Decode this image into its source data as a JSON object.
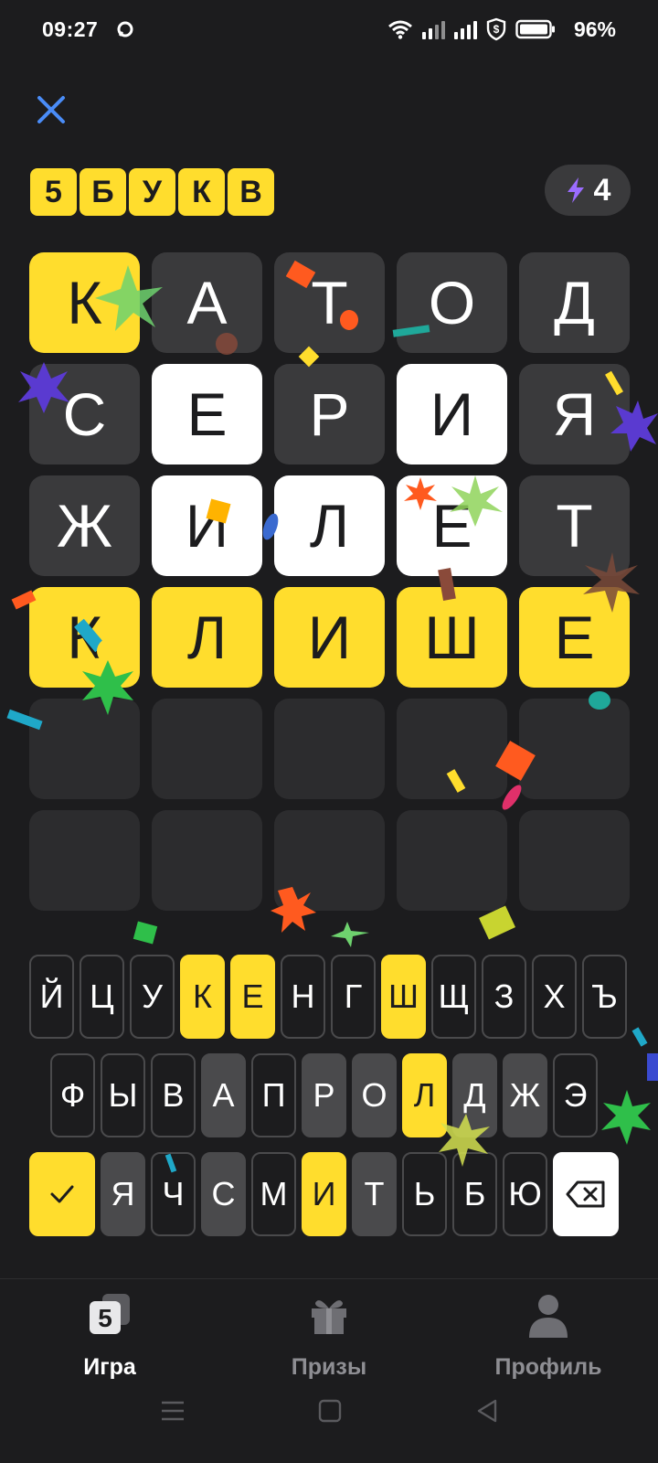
{
  "status_bar": {
    "time": "09:27",
    "battery": "96%"
  },
  "header": {
    "logo_letters": [
      "5",
      "Б",
      "У",
      "К",
      "В"
    ],
    "energy_count": "4"
  },
  "board": {
    "rows": [
      [
        {
          "letter": "К",
          "state": "correct"
        },
        {
          "letter": "А",
          "state": "absent"
        },
        {
          "letter": "Т",
          "state": "absent"
        },
        {
          "letter": "О",
          "state": "absent"
        },
        {
          "letter": "Д",
          "state": "absent"
        }
      ],
      [
        {
          "letter": "С",
          "state": "absent"
        },
        {
          "letter": "Е",
          "state": "present"
        },
        {
          "letter": "Р",
          "state": "absent"
        },
        {
          "letter": "И",
          "state": "present"
        },
        {
          "letter": "Я",
          "state": "absent"
        }
      ],
      [
        {
          "letter": "Ж",
          "state": "absent"
        },
        {
          "letter": "И",
          "state": "present"
        },
        {
          "letter": "Л",
          "state": "present"
        },
        {
          "letter": "Е",
          "state": "present"
        },
        {
          "letter": "Т",
          "state": "absent"
        }
      ],
      [
        {
          "letter": "К",
          "state": "correct"
        },
        {
          "letter": "Л",
          "state": "correct"
        },
        {
          "letter": "И",
          "state": "correct"
        },
        {
          "letter": "Ш",
          "state": "correct"
        },
        {
          "letter": "Е",
          "state": "correct"
        }
      ],
      [
        {
          "letter": "",
          "state": "empty"
        },
        {
          "letter": "",
          "state": "empty"
        },
        {
          "letter": "",
          "state": "empty"
        },
        {
          "letter": "",
          "state": "empty"
        },
        {
          "letter": "",
          "state": "empty"
        }
      ],
      [
        {
          "letter": "",
          "state": "empty"
        },
        {
          "letter": "",
          "state": "empty"
        },
        {
          "letter": "",
          "state": "empty"
        },
        {
          "letter": "",
          "state": "empty"
        },
        {
          "letter": "",
          "state": "empty"
        }
      ]
    ]
  },
  "keyboard": {
    "rows": [
      [
        {
          "k": "Й",
          "s": "unused"
        },
        {
          "k": "Ц",
          "s": "unused"
        },
        {
          "k": "У",
          "s": "unused"
        },
        {
          "k": "К",
          "s": "correct"
        },
        {
          "k": "Е",
          "s": "correct"
        },
        {
          "k": "Н",
          "s": "unused"
        },
        {
          "k": "Г",
          "s": "unused"
        },
        {
          "k": "Ш",
          "s": "correct"
        },
        {
          "k": "Щ",
          "s": "unused"
        },
        {
          "k": "З",
          "s": "unused"
        },
        {
          "k": "Х",
          "s": "unused"
        },
        {
          "k": "Ъ",
          "s": "unused"
        }
      ],
      [
        {
          "k": "Ф",
          "s": "unused"
        },
        {
          "k": "Ы",
          "s": "unused"
        },
        {
          "k": "В",
          "s": "unused"
        },
        {
          "k": "А",
          "s": "absent"
        },
        {
          "k": "П",
          "s": "unused"
        },
        {
          "k": "Р",
          "s": "absent"
        },
        {
          "k": "О",
          "s": "absent"
        },
        {
          "k": "Л",
          "s": "correct"
        },
        {
          "k": "Д",
          "s": "absent"
        },
        {
          "k": "Ж",
          "s": "absent"
        },
        {
          "k": "Э",
          "s": "unused"
        }
      ],
      [
        {
          "k": "Я",
          "s": "absent"
        },
        {
          "k": "Ч",
          "s": "unused"
        },
        {
          "k": "С",
          "s": "absent"
        },
        {
          "k": "М",
          "s": "unused"
        },
        {
          "k": "И",
          "s": "correct"
        },
        {
          "k": "Т",
          "s": "absent"
        },
        {
          "k": "Ь",
          "s": "unused"
        },
        {
          "k": "Б",
          "s": "unused"
        },
        {
          "k": "Ю",
          "s": "unused"
        }
      ]
    ]
  },
  "nav": {
    "game_label": "Игра",
    "prizes_label": "Призы",
    "profile_label": "Профиль",
    "game_icon_digit": "5"
  },
  "colors": {
    "accent_yellow": "#ffdd2d",
    "present_white": "#ffffff",
    "absent_gray": "#3a3a3c",
    "background": "#1c1c1e",
    "close_blue": "#4a8cf7",
    "energy_purple": "#9b6cff"
  }
}
